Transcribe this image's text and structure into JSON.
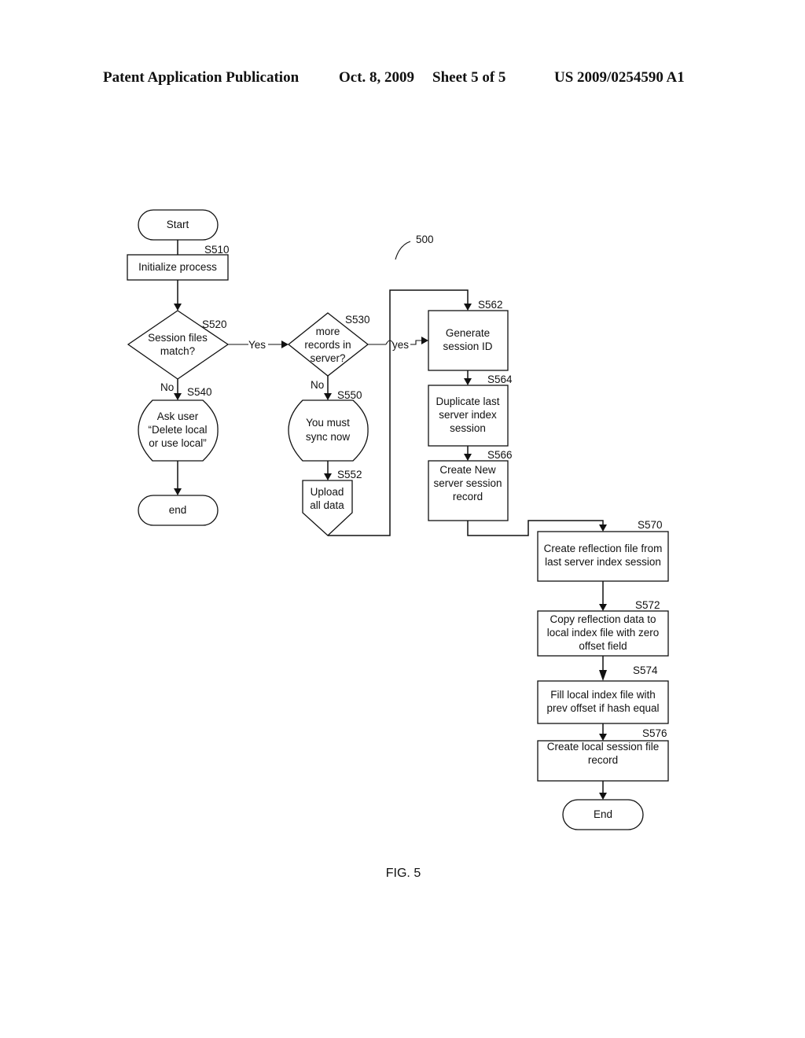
{
  "header": {
    "publication": "Patent Application Publication",
    "date": "Oct. 8, 2009",
    "sheet": "Sheet 5 of 5",
    "number": "US 2009/0254590 A1"
  },
  "figure": {
    "reference": "500",
    "caption": "FIG. 5"
  },
  "nodes": {
    "start": {
      "lines": [
        "Start"
      ]
    },
    "s510": {
      "label": "S510",
      "lines": [
        "Initialize process"
      ]
    },
    "s520": {
      "label": "S520",
      "lines": [
        "Session files",
        "match?"
      ]
    },
    "s530": {
      "label": "S530",
      "lines": [
        "more",
        "records in",
        "server?"
      ]
    },
    "s540": {
      "label": "S540",
      "lines": [
        "Ask user",
        "“Delete local",
        "or use local”"
      ]
    },
    "end1": {
      "lines": [
        "end"
      ]
    },
    "s550": {
      "label": "S550",
      "lines": [
        "You must",
        "sync now"
      ]
    },
    "s552": {
      "label": "S552",
      "lines": [
        "Upload",
        "all data"
      ]
    },
    "s562": {
      "label": "S562",
      "lines": [
        "Generate",
        "session ID"
      ]
    },
    "s564": {
      "label": "S564",
      "lines": [
        "Duplicate last",
        "server index",
        "session"
      ]
    },
    "s566": {
      "label": "S566",
      "lines": [
        "Create New",
        "server session",
        "record"
      ]
    },
    "s570": {
      "label": "S570",
      "lines": [
        "Create reflection file from",
        "last server index session"
      ]
    },
    "s572": {
      "label": "S572",
      "lines": [
        "Copy reflection data to",
        "local index file with zero",
        "offset field"
      ]
    },
    "s574": {
      "label": "S574",
      "lines": [
        "Fill local index file with",
        "prev offset if hash equal"
      ]
    },
    "s576": {
      "label": "S576",
      "lines": [
        "Create local session file",
        "record"
      ]
    },
    "end2": {
      "lines": [
        "End"
      ]
    }
  },
  "edges": {
    "yes_520": "Yes",
    "no_520": "No",
    "yes_530": "yes",
    "no_530": "No"
  }
}
